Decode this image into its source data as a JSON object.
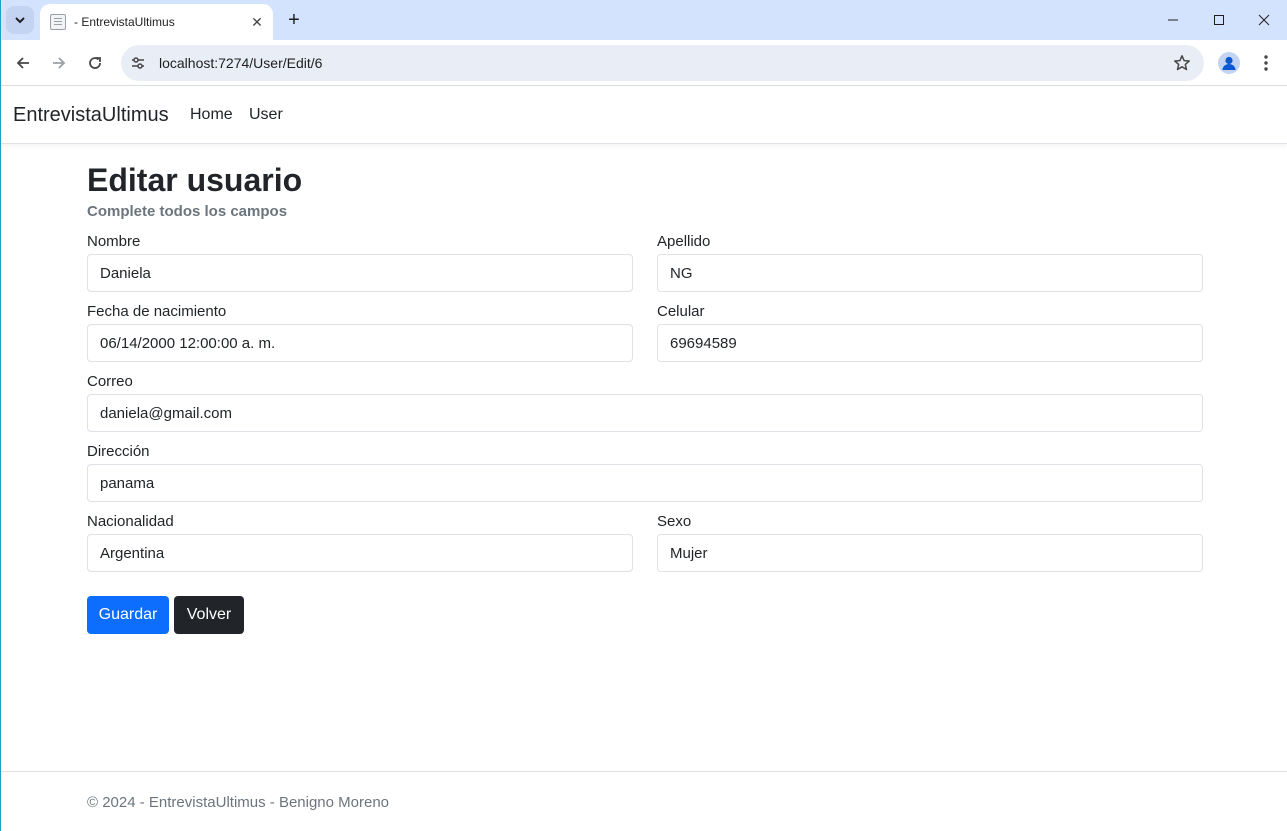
{
  "browser": {
    "tab_title": "- EntrevistaUltimus",
    "tab_close": "✕",
    "new_tab": "+",
    "url": "localhost:7274/User/Edit/6",
    "window_controls": {
      "minimize": "–",
      "maximize": "☐",
      "close": "✕"
    }
  },
  "navbar": {
    "brand": "EntrevistaUltimus",
    "links": [
      "Home",
      "User"
    ]
  },
  "form": {
    "title": "Editar usuario",
    "subtitle": "Complete todos los campos",
    "fields": {
      "nombre": {
        "label": "Nombre",
        "value": "Daniela"
      },
      "apellido": {
        "label": "Apellido",
        "value": "NG"
      },
      "fecha": {
        "label": "Fecha de nacimiento",
        "value": "06/14/2000 12:00:00 a. m."
      },
      "celular": {
        "label": "Celular",
        "value": "69694589"
      },
      "correo": {
        "label": "Correo",
        "value": "daniela@gmail.com"
      },
      "direccion": {
        "label": "Dirección",
        "value": "panama"
      },
      "nacionalidad": {
        "label": "Nacionalidad",
        "value": "Argentina"
      },
      "sexo": {
        "label": "Sexo",
        "value": "Mujer"
      }
    },
    "buttons": {
      "save": "Guardar",
      "back": "Volver"
    }
  },
  "footer": {
    "text": "© 2024 - EntrevistaUltimus - Benigno Moreno"
  },
  "colors": {
    "primary": "#0d6efd",
    "dark": "#212529",
    "muted": "#6c757d",
    "tabstrip": "#d3e3fd"
  }
}
